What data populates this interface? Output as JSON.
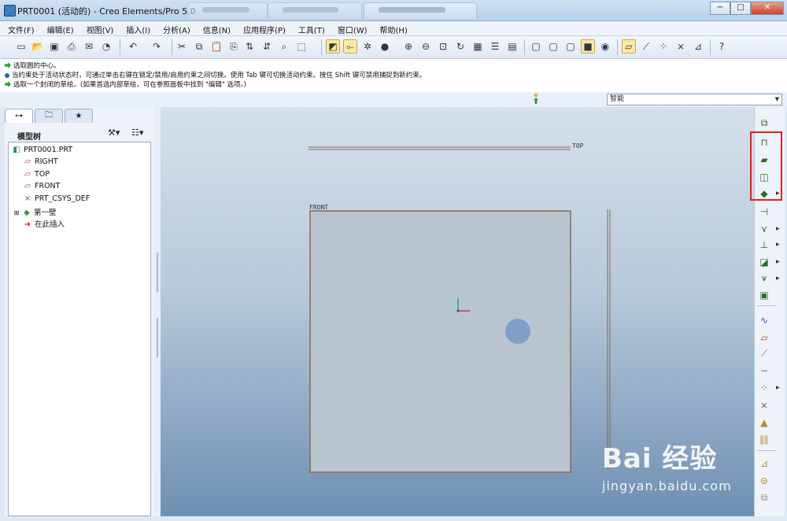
{
  "window": {
    "title": "PRT0001 (活动的) - Creo Elements/Pro 5.0",
    "buttons": {
      "minimize": "−",
      "maximize": "□",
      "close": "✕"
    }
  },
  "menu": [
    "文件(F)",
    "编辑(E)",
    "视图(V)",
    "插入(I)",
    "分析(A)",
    "信息(N)",
    "应用程序(P)",
    "工具(T)",
    "窗口(W)",
    "帮助(H)"
  ],
  "messages": [
    {
      "icon": "arrow",
      "text": "选取圆的中心。"
    },
    {
      "icon": "info",
      "text": "当约束处于活动状态时，可通过单击右键在锁定/禁用/启用约束之间切换。使用 Tab 键可切换活动约束。按住 Shift 键可禁用捕捉到新约束。"
    },
    {
      "icon": "arrow",
      "text": "选取一个封闭的草绘。(如果首选内部草绘，可在参照面板中找到 \"编辑\" 选项。)"
    }
  ],
  "filter": {
    "selected": "智能"
  },
  "model_tree": {
    "title": "模型树",
    "items": [
      {
        "label": "PRT0001.PRT",
        "icon": "part-icon"
      },
      {
        "label": "RIGHT",
        "icon": "datum-plane-icon"
      },
      {
        "label": "TOP",
        "icon": "datum-plane-icon"
      },
      {
        "label": "FRONT",
        "icon": "datum-plane-icon"
      },
      {
        "label": "PRT_CSYS_DEF",
        "icon": "csys-icon"
      },
      {
        "label": "第一壁",
        "icon": "sheetmetal-wall-icon"
      },
      {
        "label": "在此插入",
        "icon": "insert-here-arrow-icon"
      }
    ]
  },
  "canvas": {
    "datum_labels": {
      "top": "TOP",
      "front": "FRONT"
    }
  },
  "watermark": {
    "main": "Bai 经验",
    "sub": "jingyan.baidu.com"
  },
  "colors": {
    "highlight": "#e3201b",
    "accent": "#fbe8a6"
  }
}
